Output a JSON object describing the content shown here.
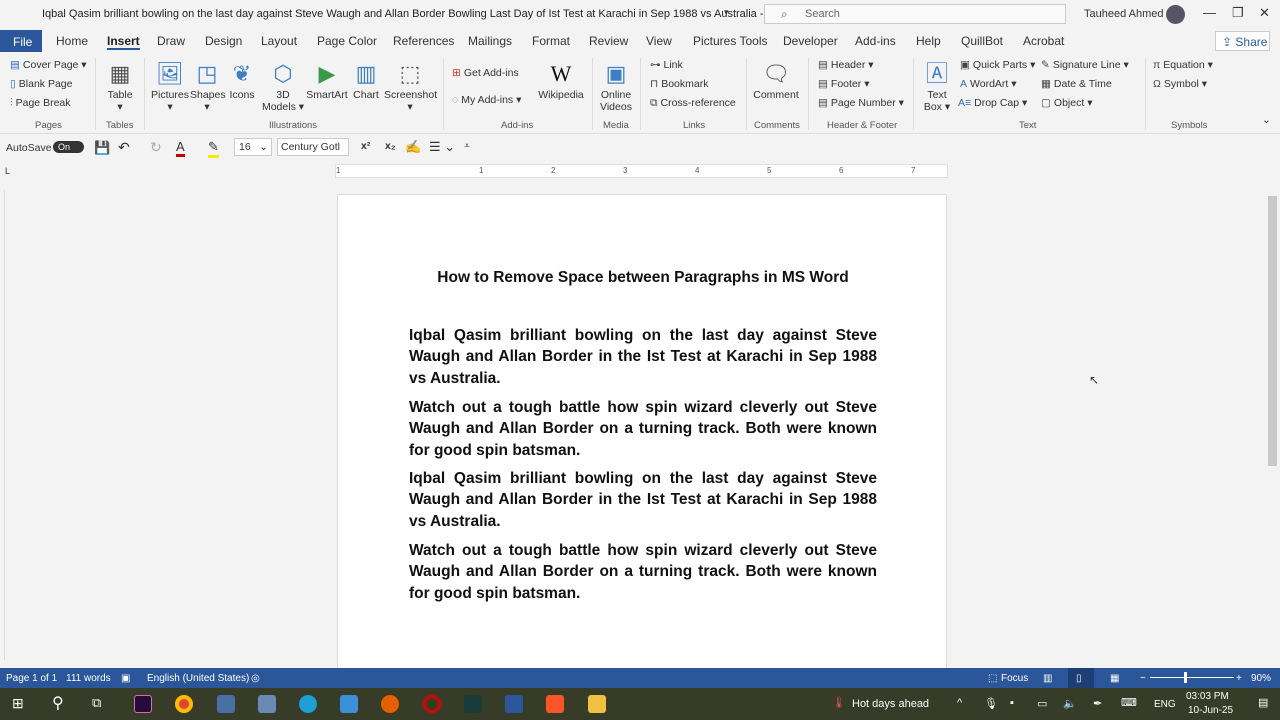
{
  "window": {
    "title": "Iqbal Qasim brilliant bowling on the last day against Steve Waugh and Allan Border Bowling Last Day of Ist Test at Karachi in Sep 1988 vs Australia  -  Saved",
    "search_placeholder": "Search",
    "user": "Tauheed Ahmed"
  },
  "tabs": [
    "File",
    "Home",
    "Insert",
    "Draw",
    "Design",
    "Layout",
    "Page Color",
    "References",
    "Mailings",
    "Format",
    "Review",
    "View",
    "Pictures Tools",
    "Developer",
    "Add-ins",
    "Help",
    "QuillBot",
    "Acrobat"
  ],
  "share": "Share",
  "ribbon": {
    "pages": {
      "label": "Pages",
      "items": [
        "Cover Page",
        "Blank Page",
        "Page Break"
      ]
    },
    "tables": {
      "label": "Tables",
      "items": [
        "Table"
      ]
    },
    "illustrations": {
      "label": "Illustrations",
      "items": [
        "Pictures",
        "Shapes",
        "Icons",
        "3D Models",
        "SmartArt",
        "Chart",
        "Screenshot"
      ]
    },
    "addins": {
      "label": "Add-ins",
      "items": [
        "Get Add-ins",
        "My Add-ins",
        "Wikipedia"
      ]
    },
    "media": {
      "label": "Media",
      "items": [
        "Online Videos"
      ]
    },
    "links": {
      "label": "Links",
      "items": [
        "Link",
        "Bookmark",
        "Cross-reference"
      ]
    },
    "comments": {
      "label": "Comments",
      "items": [
        "Comment"
      ]
    },
    "header_footer": {
      "label": "Header & Footer",
      "items": [
        "Header",
        "Footer",
        "Page Number"
      ]
    },
    "text": {
      "label": "Text",
      "items": [
        "Text Box",
        "Quick Parts",
        "WordArt",
        "Drop Cap",
        "Signature Line",
        "Date & Time",
        "Object"
      ]
    },
    "symbols": {
      "label": "Symbols",
      "items": [
        "Equation",
        "Symbol"
      ]
    }
  },
  "quick_access": {
    "autosave": "AutoSave",
    "autosave_state": "On",
    "font_size": "16",
    "font_name": "Century Gotl"
  },
  "ruler": [
    "1",
    "1",
    "2",
    "3",
    "4",
    "5",
    "6",
    "7"
  ],
  "document": {
    "title": "How to Remove Space between Paragraphs in MS Word",
    "paragraphs": [
      "Iqbal Qasim brilliant bowling on the last day against Steve Waugh and Allan Border in the Ist Test at Karachi in Sep 1988 vs Australia.",
      "Watch out a tough battle how spin wizard cleverly out Steve Waugh and Allan Border on a turning track. Both were known for good spin batsman.",
      "Iqbal Qasim brilliant bowling on the last day against Steve Waugh and Allan Border in the Ist Test at Karachi in Sep 1988 vs Australia.",
      "Watch out a tough battle how spin wizard cleverly out Steve Waugh and Allan Border on a turning track. Both were known for good spin batsman."
    ]
  },
  "status": {
    "page": "Page 1 of 1",
    "words": "111 words",
    "language": "English (United States)",
    "focus": "Focus",
    "zoom": "90%"
  },
  "taskbar": {
    "weather": "Hot days ahead",
    "lang": "ENG",
    "time": "03:03 PM",
    "date": "10-Jun-25"
  }
}
